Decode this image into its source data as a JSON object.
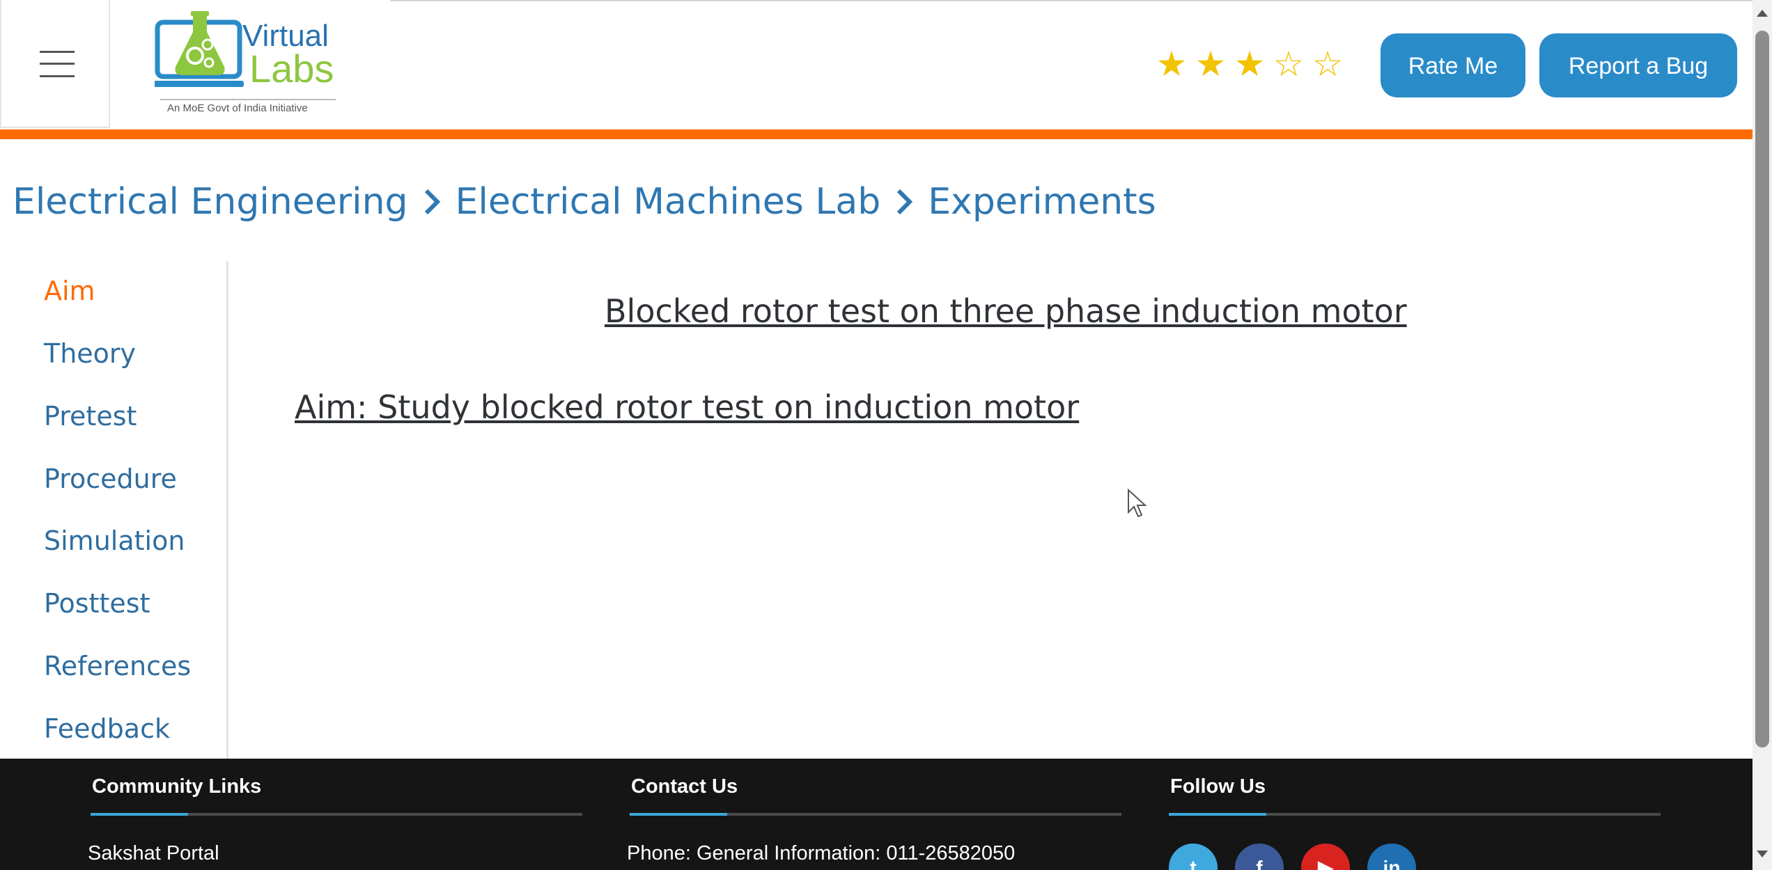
{
  "header": {
    "logo": {
      "line1": "Virtual",
      "line2": "Labs",
      "tagline": "An MoE Govt of India Initiative"
    },
    "rating": {
      "value": 3,
      "max": 5
    },
    "rate_button": "Rate Me",
    "bug_button": "Report a Bug"
  },
  "breadcrumb": {
    "items": [
      "Electrical Engineering",
      "Electrical Machines Lab",
      "Experiments"
    ]
  },
  "sidebar": {
    "items": [
      {
        "label": "Aim",
        "active": true
      },
      {
        "label": "Theory"
      },
      {
        "label": "Pretest"
      },
      {
        "label": "Procedure"
      },
      {
        "label": "Simulation"
      },
      {
        "label": "Posttest"
      },
      {
        "label": "References"
      },
      {
        "label": "Feedback"
      }
    ]
  },
  "main": {
    "title": "Blocked rotor test on three phase induction motor",
    "aim": "Aim: Study blocked rotor test on induction motor"
  },
  "footer": {
    "community": {
      "title": "Community Links",
      "first_link": "Sakshat Portal"
    },
    "contact": {
      "title": "Contact Us",
      "phone": "Phone: General Information: 011-26582050"
    },
    "follow": {
      "title": "Follow Us",
      "icons": [
        {
          "name": "twitter-icon",
          "glyph": "t",
          "color": "#3fa9de"
        },
        {
          "name": "facebook-icon",
          "glyph": "f",
          "color": "#3b5998"
        },
        {
          "name": "youtube-icon",
          "glyph": "▶",
          "color": "#d9231f"
        },
        {
          "name": "linkedin-icon",
          "glyph": "in",
          "color": "#1f6fb2"
        }
      ]
    }
  },
  "colors": {
    "accent": "#ff6a00",
    "link": "#2f77b1",
    "button": "#2a8bc9",
    "footer": "#151515",
    "star": "#f2c300"
  }
}
